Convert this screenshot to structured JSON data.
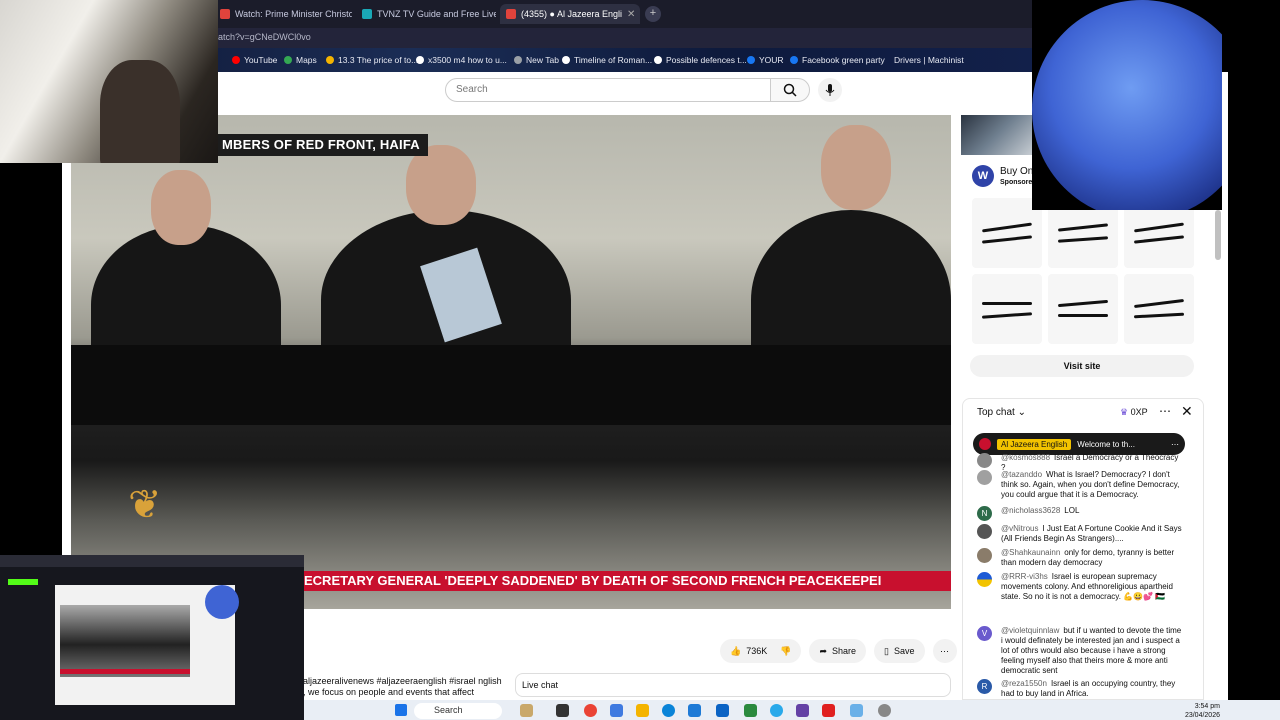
{
  "browser": {
    "tabs": [
      {
        "label": "Watch: Prime Minister Christo",
        "color": "#e0433c"
      },
      {
        "label": "TVNZ TV Guide and Free Live",
        "color": "#1aa8b6"
      },
      {
        "label": "(4355) ● Al Jazeera Engli",
        "color": "#e0433c"
      }
    ],
    "url": "atch?v=gCNeDWCl0vo",
    "bookmarks": [
      {
        "label": "YouTube",
        "color": "#ff0000"
      },
      {
        "label": "Maps",
        "color": "#34a853"
      },
      {
        "label": "13.3 The price of to...",
        "color": "#f4b400"
      },
      {
        "label": "x3500 m4 how to u...",
        "color": "#ffffff"
      },
      {
        "label": "New Tab",
        "color": "#9aa0a6"
      },
      {
        "label": "Timeline of Roman...",
        "color": "#ffffff"
      },
      {
        "label": "Possible defences t...",
        "color": "#ffffff"
      },
      {
        "label": "YOUR",
        "color": "#1877f2"
      },
      {
        "label": "Facebook green party",
        "color": "#1877f2"
      },
      {
        "label": "Drivers | Machinist",
        "color": "#444444"
      }
    ]
  },
  "search": {
    "placeholder": "Search"
  },
  "video": {
    "top_caption": "MBERS OF RED FRONT, HAIFA",
    "ticker": "ECRETARY GENERAL 'DEEPLY SADDENED' BY DEATH OF SECOND FRENCH PEACEKEEPEI"
  },
  "actions": {
    "likes": "736K",
    "share": "Share",
    "save": "Save"
  },
  "description": {
    "text": "aljazeeralivenews #aljazeeraenglish #israel nglish , we focus on people and events that affect"
  },
  "livechat_label": "Live chat",
  "ad": {
    "title": "Buy Onl",
    "sponsor": "Sponsore",
    "logo": "W",
    "visit": "Visit site"
  },
  "chat": {
    "header": "Top chat",
    "xp": "0XP",
    "pinned_channel": "Al Jazeera English",
    "pinned_text": "Welcome to th...",
    "messages": [
      {
        "user": "@kosmos888",
        "text": "Israel a Democracy or a Theocracy ?",
        "color": "#888888"
      },
      {
        "user": "@tazanddo",
        "text": "What is Israel? Democracy? I don't think so. Again, when you don't define Democracy, you could argue that it is a Democracy.",
        "color": "#a0a0a0"
      },
      {
        "user": "@nicholass3628",
        "text": "LOL",
        "color": "#2e6b4a",
        "initial": "N"
      },
      {
        "user": "@vNitrous",
        "text": "I Just Eat A Fortune Cookie And it Says (All Friends Begin As Strangers)....",
        "color": "#555555"
      },
      {
        "user": "@Shahkaunainn",
        "text": "only for demo, tyranny is better than modern day democracy",
        "color": "#8a7c6a"
      },
      {
        "user": "@RRR-vi3hs",
        "text": "Israel is european supremacy movements colony. And ethnoreligious apartheid state. So no it is not a democracy. 💪😀💕 🇵🇸",
        "color": "#f2c300"
      },
      {
        "user": "@violetquinnlaw",
        "text": "but if u wanted to devote the time i would definately be interested jan and i suspect a lot of othrs would also because i have a strong feeling myself also that theirs more & more anti democratic sent",
        "color": "#6a5acd",
        "initial": "V"
      },
      {
        "user": "@reza1550n",
        "text": "Israel is an occupying country, they had to buy land in Africa.",
        "color": "#2a5aa8",
        "initial": "R"
      }
    ]
  },
  "taskbar": {
    "search": "Search",
    "time": "3:54 pm",
    "date": "23/04/2026"
  }
}
